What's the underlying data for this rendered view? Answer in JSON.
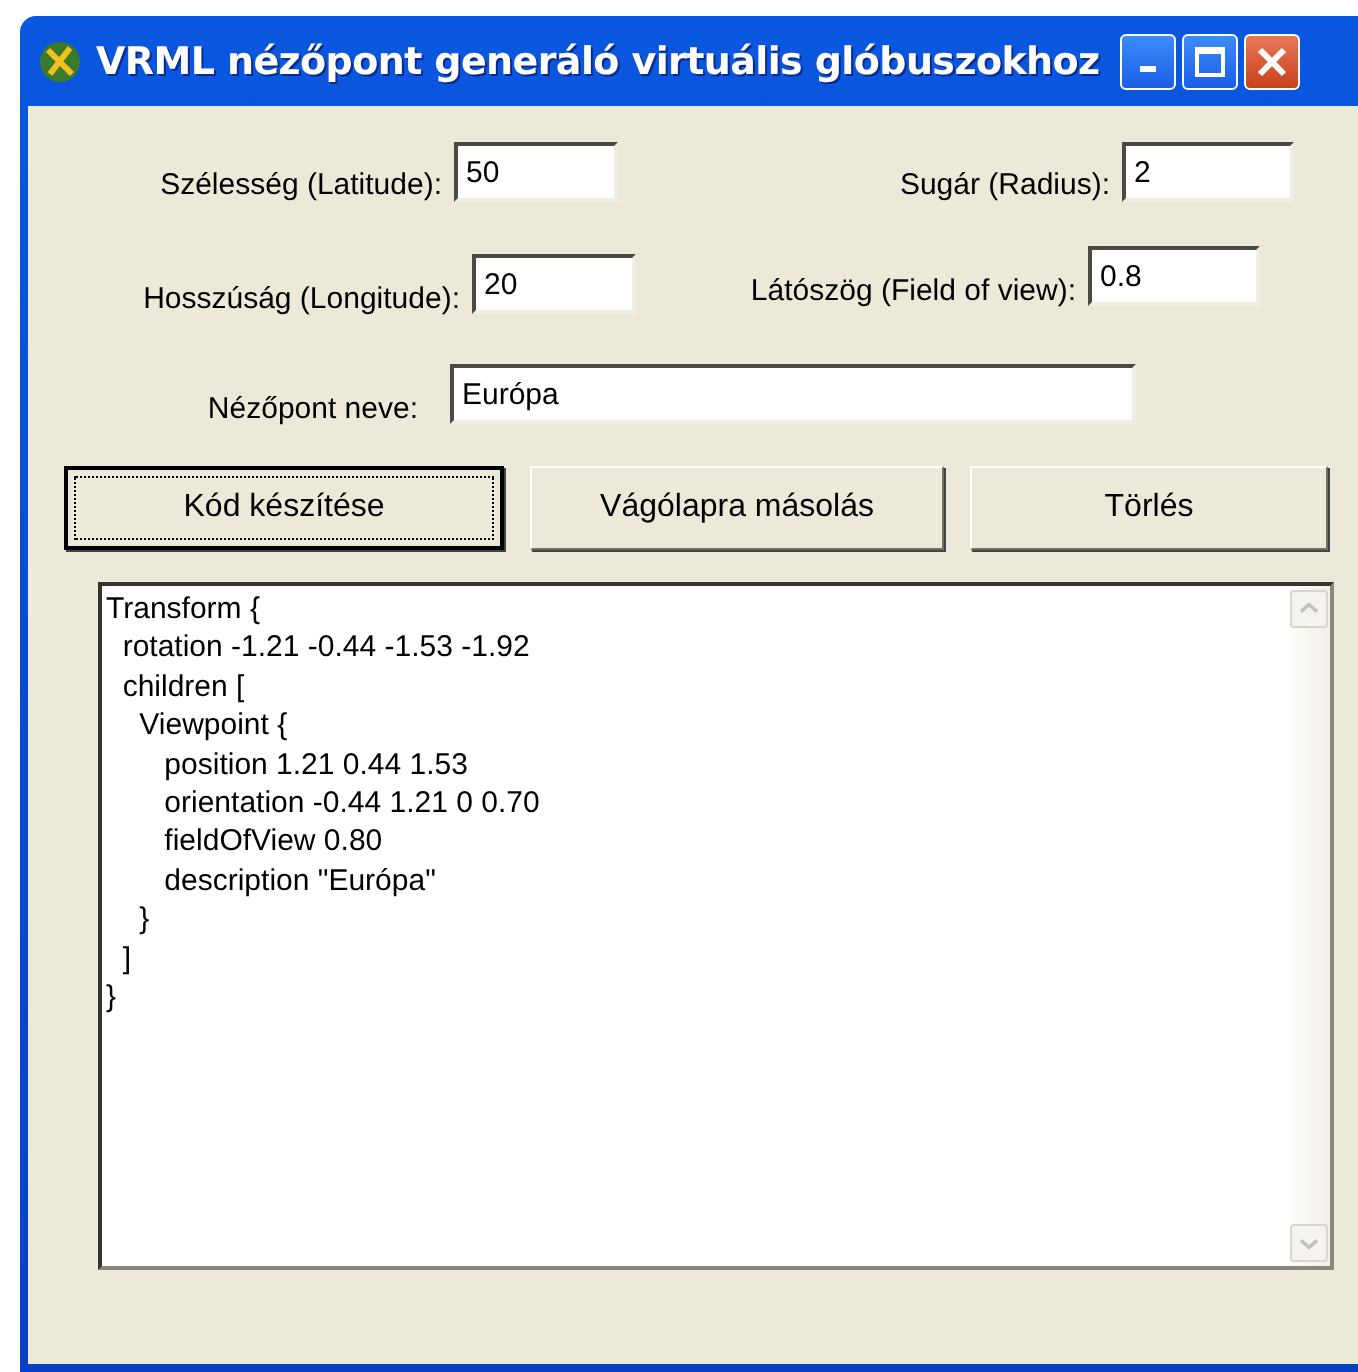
{
  "window": {
    "title": "VRML nézőpont generáló virtuális glóbuszokhoz"
  },
  "fields": [
    {
      "label": "Szélesség (Latitude):",
      "value": "50"
    },
    {
      "label": "Sugár (Radius):",
      "value": "2"
    },
    {
      "label": "Hosszúság (Longitude):",
      "value": "20"
    },
    {
      "label": "Látószög (Field of view):",
      "value": "0.8"
    }
  ],
  "name_field": {
    "label": "Nézőpont neve:",
    "value": "Európa"
  },
  "buttons": [
    {
      "label": "Kód készítése",
      "focused": true
    },
    {
      "label": "Vágólapra másolás",
      "focused": false
    },
    {
      "label": "Törlés",
      "focused": false
    }
  ],
  "code_lines": [
    "Transform {",
    "  rotation -1.21 -0.44 -1.53 -1.92",
    "  children [",
    "    Viewpoint {",
    "       position 1.21 0.44 1.53",
    "       orientation -0.44 1.21 0 0.70",
    "       fieldOfView 0.80",
    "       description \"Európa\"",
    "    }",
    "  ]",
    "}"
  ]
}
